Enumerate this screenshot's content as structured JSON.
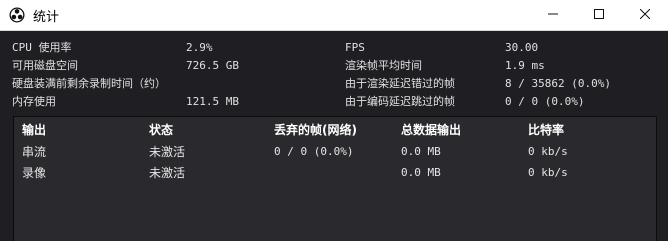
{
  "window": {
    "title": "统计",
    "controls": {
      "minimize": "—",
      "maximize": "☐",
      "close": "✕"
    }
  },
  "stats_left": [
    {
      "label": "CPU 使用率",
      "value": "2.9%"
    },
    {
      "label": "可用磁盘空间",
      "value": "726.5 GB"
    },
    {
      "label": "硬盘装满前剩余录制时间（约）",
      "value": ""
    },
    {
      "label": "内存使用",
      "value": "121.5 MB"
    }
  ],
  "stats_right": [
    {
      "label": "FPS",
      "value": "30.00"
    },
    {
      "label": "渲染帧平均时间",
      "value": "1.9 ms"
    },
    {
      "label": "由于渲染延迟错过的帧",
      "value": "8 / 35862 (0.0%)"
    },
    {
      "label": "由于编码延迟跳过的帧",
      "value": "0 / 0 (0.0%)"
    }
  ],
  "table": {
    "headers": [
      "输出",
      "状态",
      "丢弃的帧(网络)",
      "总数据输出",
      "比特率"
    ],
    "rows": [
      {
        "output": "串流",
        "status": "未激活",
        "dropped": "0 / 0 (0.0%)",
        "total": "0.0 MB",
        "bitrate": "0 kb/s"
      },
      {
        "output": "录像",
        "status": "未激活",
        "dropped": "",
        "total": "0.0 MB",
        "bitrate": "0 kb/s"
      }
    ]
  }
}
